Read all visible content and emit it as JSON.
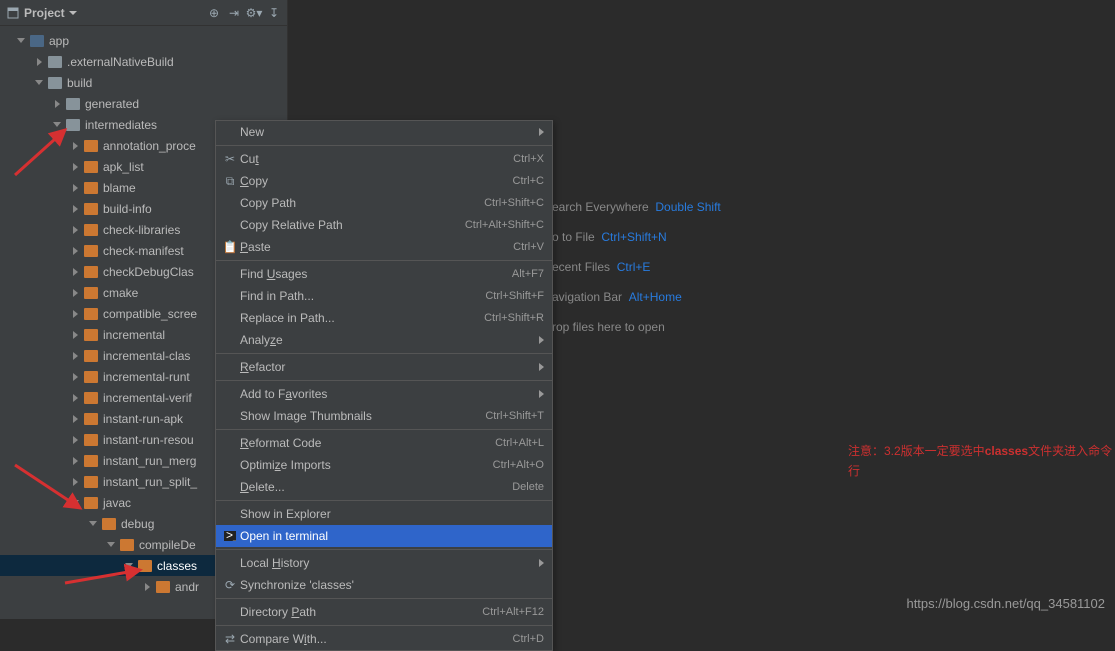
{
  "toolbar": {
    "label": "Project"
  },
  "tree": {
    "app": "app",
    "externalNativeBuild": ".externalNativeBuild",
    "build": "build",
    "generated": "generated",
    "intermediates": "intermediates",
    "items": [
      "annotation_proce",
      "apk_list",
      "blame",
      "build-info",
      "check-libraries",
      "check-manifest",
      "checkDebugClas",
      "cmake",
      "compatible_scree",
      "incremental",
      "incremental-clas",
      "incremental-runt",
      "incremental-verif",
      "instant-run-apk",
      "instant-run-resou",
      "instant_run_merg",
      "instant_run_split_"
    ],
    "javac": "javac",
    "debug": "debug",
    "compileDe": "compileDe",
    "classes": "classes",
    "andr": "andr"
  },
  "menu": {
    "new": "New",
    "cut": "Cut",
    "cut_sc": "Ctrl+X",
    "copy": "Copy",
    "copy_sc": "Ctrl+C",
    "copy_path": "Copy Path",
    "copy_path_sc": "Ctrl+Shift+C",
    "copy_rel": "Copy Relative Path",
    "copy_rel_sc": "Ctrl+Alt+Shift+C",
    "paste": "Paste",
    "paste_sc": "Ctrl+V",
    "find_usages": "Find Usages",
    "find_usages_sc": "Alt+F7",
    "find_in_path": "Find in Path...",
    "find_in_path_sc": "Ctrl+Shift+F",
    "replace_in_path": "Replace in Path...",
    "replace_in_path_sc": "Ctrl+Shift+R",
    "analyze": "Analyze",
    "refactor": "Refactor",
    "add_fav": "Add to Favorites",
    "show_thumbs": "Show Image Thumbnails",
    "show_thumbs_sc": "Ctrl+Shift+T",
    "reformat": "Reformat Code",
    "reformat_sc": "Ctrl+Alt+L",
    "optimize": "Optimize Imports",
    "optimize_sc": "Ctrl+Alt+O",
    "delete": "Delete...",
    "delete_sc": "Delete",
    "show_explorer": "Show in Explorer",
    "open_terminal": "Open in terminal",
    "local_history": "Local History",
    "sync": "Synchronize 'classes'",
    "dir_path": "Directory Path",
    "dir_path_sc": "Ctrl+Alt+F12",
    "compare": "Compare With...",
    "compare_sc": "Ctrl+D"
  },
  "hints": {
    "search": "earch Everywhere",
    "search_key": "Double Shift",
    "gotofile": "o to File",
    "gotofile_key": "Ctrl+Shift+N",
    "recent": "ecent Files",
    "recent_key": "Ctrl+E",
    "navbar": "avigation Bar",
    "navbar_key": "Alt+Home",
    "drop": "rop files here to open"
  },
  "note": {
    "prefix": "注意：3.2版本一定要选中",
    "bold": "classes",
    "suffix": "文件夹进入命令行"
  },
  "watermark": "https://blog.csdn.net/qq_34581102"
}
